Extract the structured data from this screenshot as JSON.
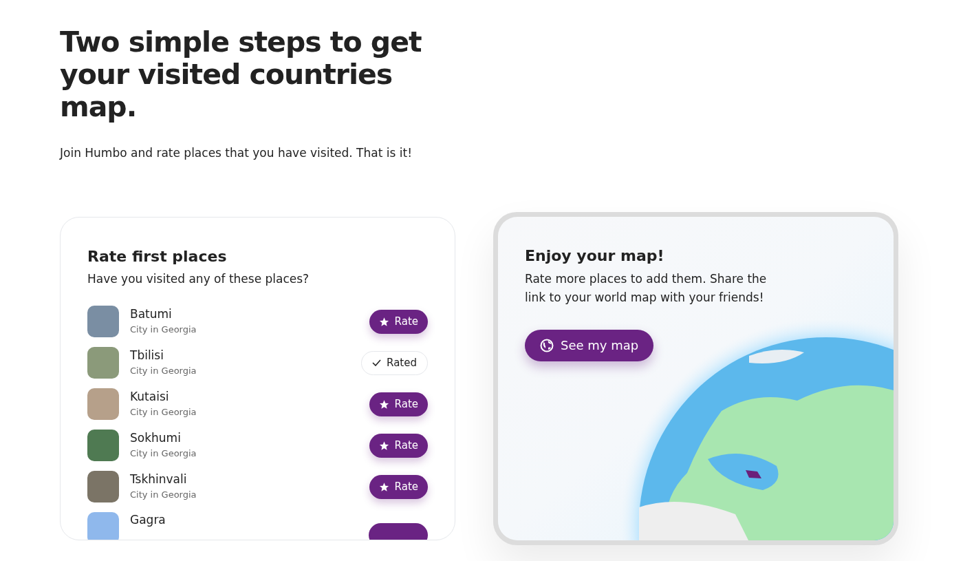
{
  "heading": "Two simple steps to get your visited countries map.",
  "subtitle": "Join Humbo and rate places that you have visited. That is it!",
  "rate_card": {
    "title": "Rate first places",
    "question": "Have you visited any of these places?",
    "places": [
      {
        "name": "Batumi",
        "subtitle": "City in Georgia",
        "button": "Rate",
        "rated": false
      },
      {
        "name": "Tbilisi",
        "subtitle": "City in Georgia",
        "button": "Rated",
        "rated": true
      },
      {
        "name": "Kutaisi",
        "subtitle": "City in Georgia",
        "button": "Rate",
        "rated": false
      },
      {
        "name": "Sokhumi",
        "subtitle": "City in Georgia",
        "button": "Rate",
        "rated": false
      },
      {
        "name": "Tskhinvali",
        "subtitle": "City in Georgia",
        "button": "Rate",
        "rated": false
      },
      {
        "name": "Gagra",
        "rated": false
      }
    ]
  },
  "map_card": {
    "title": "Enjoy your map!",
    "text": "Rate more places to add them. Share the link to your world map with your friends!",
    "button": "See my map"
  }
}
